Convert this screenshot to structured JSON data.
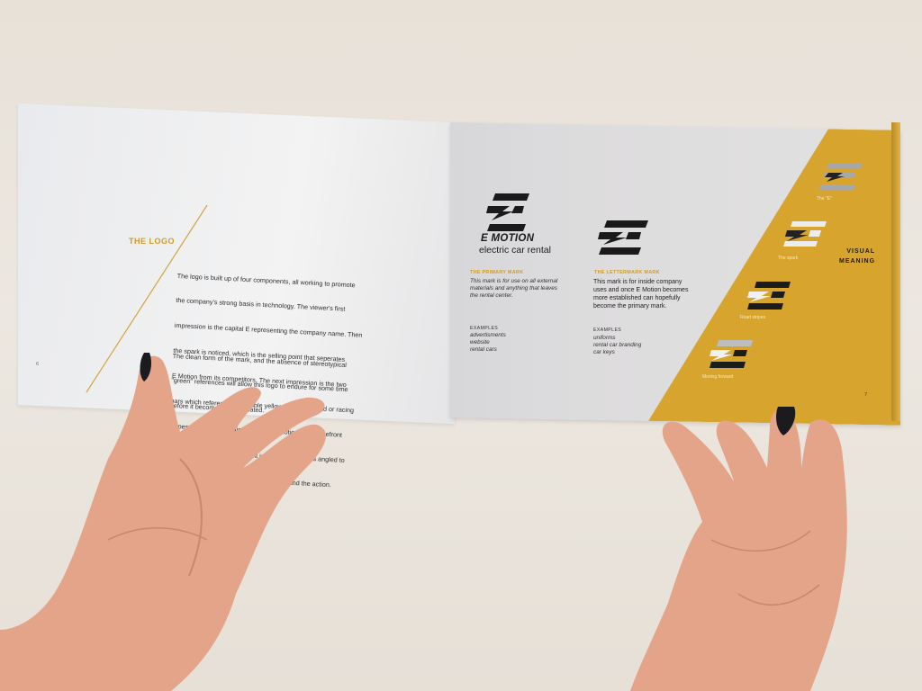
{
  "left_page": {
    "heading": "THE LOGO",
    "body_lines": [
      "The logo is built up of four components, all working to promote",
      "the company's strong basis in technology. The viewer's first",
      "impression is the capital E representing the company name. Then",
      "the spark is noticed, which is the selling point that seperates",
      "E Motion from its competitors. The next impression is the two",
      "bars which reference the double yellow line of the road or racing",
      "stripes; bringing the main service of E Motion to the forefront",
      "for the viewer. The last element is the whole mark is angled to",
      "reference moving forward; both in thinking and the action."
    ],
    "body2_lines": [
      "The clean form of the mark, and the absence of stereotypical",
      "\"green\" references will allow this logo to endure for some time",
      "before it becomes visually dated."
    ],
    "page_number": "6"
  },
  "right_page": {
    "brand_name": "E MOTION",
    "tagline": "electric car rental",
    "primary": {
      "title": "THE PRIMARY MARK",
      "desc": "This mark is for use on all external\nmaterials and anything that leaves\nthe rental center.",
      "examples_label": "EXAMPLES",
      "examples": "advertisments\nwebsite\nrental cars"
    },
    "lettermark": {
      "title": "THE LETTERMARK MARK",
      "desc": "This mark is for inside company\nuses and once E Motion becomes\nmore established can hopefully\nbecome the primary mark.",
      "examples_label": "EXAMPLES",
      "examples": "uniforms\nrental car branding\ncar keys"
    },
    "visual_meaning": "VISUAL\nMEANING",
    "icon_captions": [
      "The \"E\"",
      "The spark",
      "Road stripes",
      "Moving forward"
    ],
    "page_number": "7"
  },
  "colors": {
    "accent_yellow": "#d7a52d",
    "heading_gold": "#cf9c2a",
    "mark_black": "#1a1a1a",
    "skin": "#e3a288",
    "nail": "#1b1b1f"
  },
  "icons": [
    "e-mark-logo-icon",
    "lettermark-icon",
    "letter-e-icon",
    "spark-icon",
    "road-stripes-icon",
    "moving-forward-icon"
  ]
}
